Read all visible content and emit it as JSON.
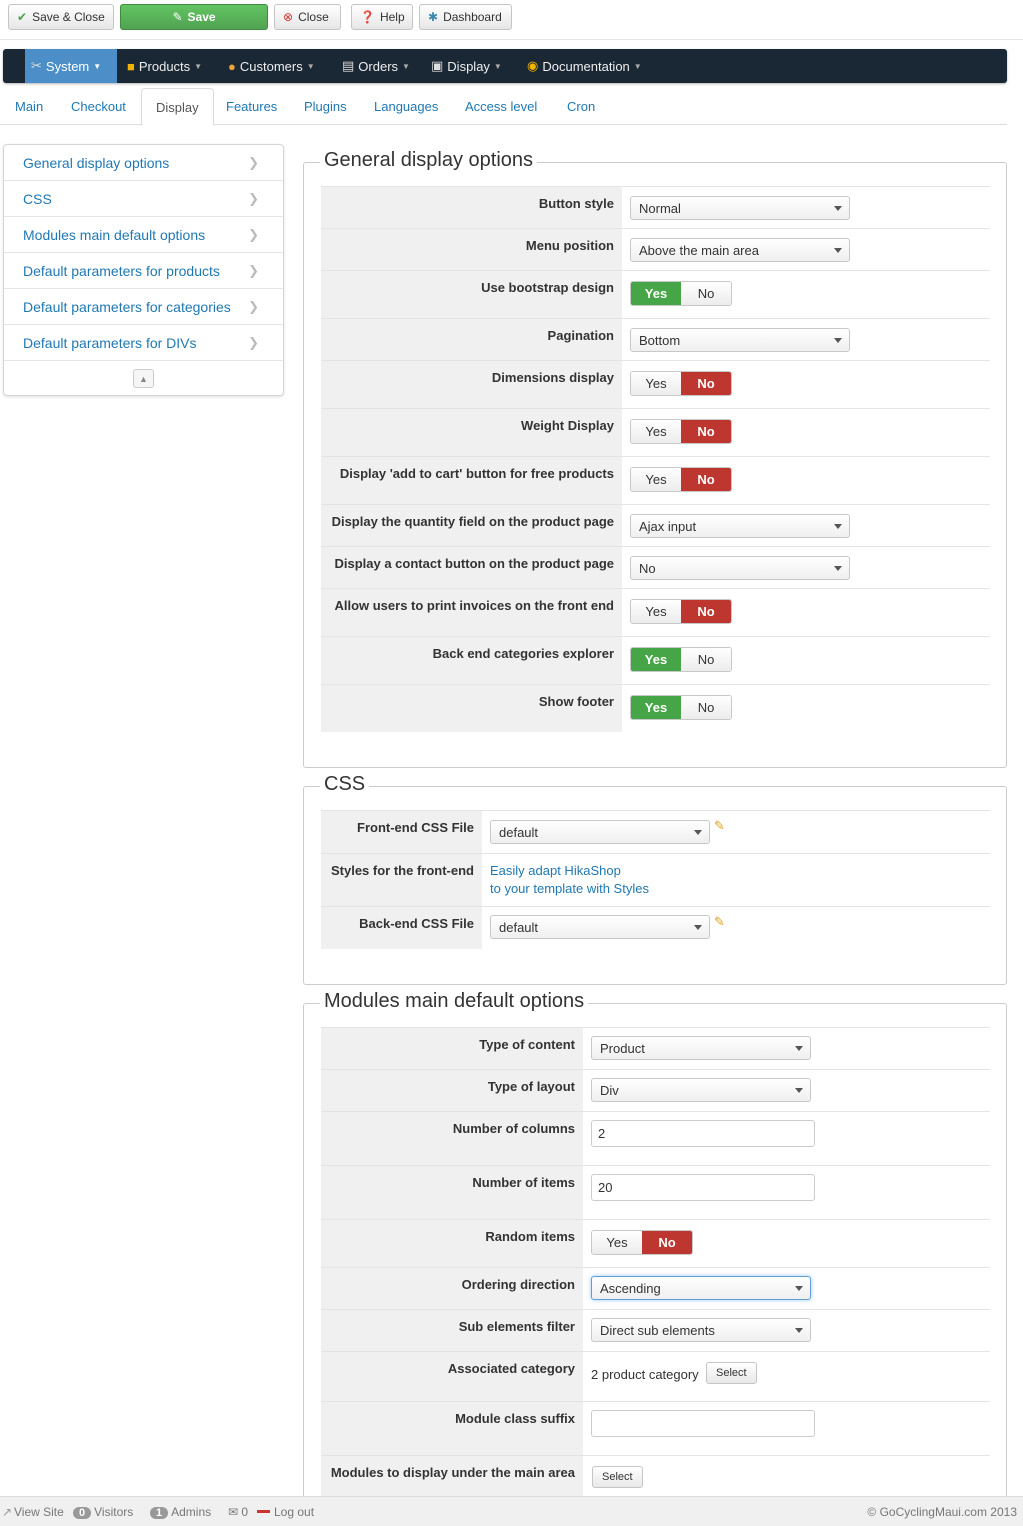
{
  "toolbar": {
    "save_close": "Save & Close",
    "save": "Save",
    "close": "Close",
    "help": "Help",
    "dashboard": "Dashboard"
  },
  "menu": {
    "system": "System",
    "products": "Products",
    "customers": "Customers",
    "orders": "Orders",
    "display": "Display",
    "documentation": "Documentation"
  },
  "tabs": [
    "Main",
    "Checkout",
    "Display",
    "Features",
    "Plugins",
    "Languages",
    "Access level",
    "Cron"
  ],
  "sidenav": [
    "General display options",
    "CSS",
    "Modules main default options",
    "Default parameters for products",
    "Default parameters for categories",
    "Default parameters for DIVs"
  ],
  "general": {
    "title": "General display options",
    "button_style": {
      "label": "Button style",
      "value": "Normal"
    },
    "menu_position": {
      "label": "Menu position",
      "value": "Above the main area"
    },
    "bootstrap": {
      "label": "Use bootstrap design",
      "state": "Yes"
    },
    "pagination": {
      "label": "Pagination",
      "value": "Bottom"
    },
    "dimensions": {
      "label": "Dimensions display",
      "state": "No"
    },
    "weight": {
      "label": "Weight Display",
      "state": "No"
    },
    "add_to_cart": {
      "label": "Display 'add to cart' button for free products",
      "state": "No"
    },
    "quantity": {
      "label": "Display the quantity field on the product page",
      "value": "Ajax input"
    },
    "contact": {
      "label": "Display a contact button on the product page",
      "value": "No"
    },
    "print_invoices": {
      "label": "Allow users to print invoices on the front end",
      "state": "No"
    },
    "cat_explorer": {
      "label": "Back end categories explorer",
      "state": "Yes"
    },
    "footer": {
      "label": "Show footer",
      "state": "Yes"
    }
  },
  "css": {
    "title": "CSS",
    "frontend": {
      "label": "Front-end CSS File",
      "value": "default"
    },
    "styles": {
      "label": "Styles for the front-end",
      "link1": "Easily adapt HikaShop",
      "link2": "to your template with Styles"
    },
    "backend": {
      "label": "Back-end CSS File",
      "value": "default"
    }
  },
  "modules": {
    "title": "Modules main default options",
    "type_content": {
      "label": "Type of content",
      "value": "Product"
    },
    "type_layout": {
      "label": "Type of layout",
      "value": "Div"
    },
    "columns": {
      "label": "Number of columns",
      "value": "2"
    },
    "items": {
      "label": "Number of items",
      "value": "20"
    },
    "random": {
      "label": "Random items",
      "state": "No"
    },
    "ordering": {
      "label": "Ordering direction",
      "value": "Ascending"
    },
    "sub_filter": {
      "label": "Sub elements filter",
      "value": "Direct sub elements"
    },
    "assoc_cat": {
      "label": "Associated category",
      "value": "2 product category",
      "button": "Select"
    },
    "suffix": {
      "label": "Module class suffix",
      "value": ""
    },
    "under_main": {
      "label": "Modules to display under the main area",
      "button": "Select"
    }
  },
  "toggle": {
    "yes": "Yes",
    "no": "No"
  },
  "footer": {
    "view_site": "View Site",
    "visitors_count": "0",
    "visitors": "Visitors",
    "admins_count": "1",
    "admins": "Admins",
    "mail_count": "0",
    "logout": "Log out",
    "copyright": "© GoCyclingMaui.com 2013"
  }
}
